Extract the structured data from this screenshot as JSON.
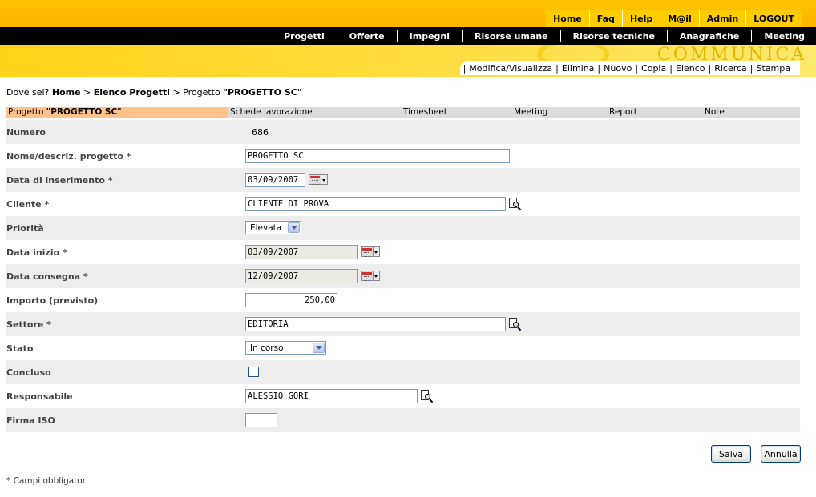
{
  "top_nav": [
    "Home",
    "Faq",
    "Help",
    "M@il",
    "Admin",
    "LOGOUT"
  ],
  "main_nav": [
    "Progetti",
    "Offerte",
    "Impegni",
    "Risorse umane",
    "Risorse tecniche",
    "Anagrafiche",
    "Meeting"
  ],
  "banner": {
    "watermark": "COMMUNICA"
  },
  "sub_nav": [
    "Modifica/Visualizza",
    "Elimina",
    "Nuovo",
    "Copia",
    "Elenco",
    "Ricerca",
    "Stampa"
  ],
  "breadcrumb": {
    "prefix": "Dove sei?",
    "home": "Home",
    "list": "Elenco Progetti",
    "current_prefix": "Progetto",
    "current_name": "\"PROGETTO SC\""
  },
  "tabs": {
    "active_prefix": "Progetto",
    "active_name": "\"PROGETTO SC\"",
    "items": [
      "Schede lavorazione",
      "Timesheet",
      "Meeting",
      "Report",
      "Note"
    ]
  },
  "form": {
    "numero": {
      "label": "Numero",
      "value": "686"
    },
    "nome": {
      "label": "Nome/descriz. progetto *",
      "value": "PROGETTO SC"
    },
    "data_inserimento": {
      "label": "Data di inserimento *",
      "value": "03/09/2007"
    },
    "cliente": {
      "label": "Cliente *",
      "value": "CLIENTE DI PROVA"
    },
    "priorita": {
      "label": "Priorità",
      "value": "Elevata"
    },
    "data_inizio": {
      "label": "Data inizio *",
      "value": "03/09/2007"
    },
    "data_consegna": {
      "label": "Data consegna *",
      "value": "12/09/2007"
    },
    "importo": {
      "label": "Importo (previsto)",
      "value": "250,00"
    },
    "settore": {
      "label": "Settore *",
      "value": "EDITORIA"
    },
    "stato": {
      "label": "Stato",
      "value": "In corso"
    },
    "concluso": {
      "label": "Concluso",
      "checked": false
    },
    "responsabile": {
      "label": "Responsabile",
      "value": "ALESSIO GORI"
    },
    "firma_iso": {
      "label": "Firma ISO",
      "value": ""
    }
  },
  "buttons": {
    "save": "Salva",
    "cancel": "Annulla"
  },
  "footer_note": "* Campi obbligatori",
  "colors": {
    "header_yellow": "#ffc400",
    "nav_black": "#000000",
    "active_tab": "#ffc28a",
    "row_shade": "#ededed",
    "tab_bar": "#dcdcdc"
  }
}
